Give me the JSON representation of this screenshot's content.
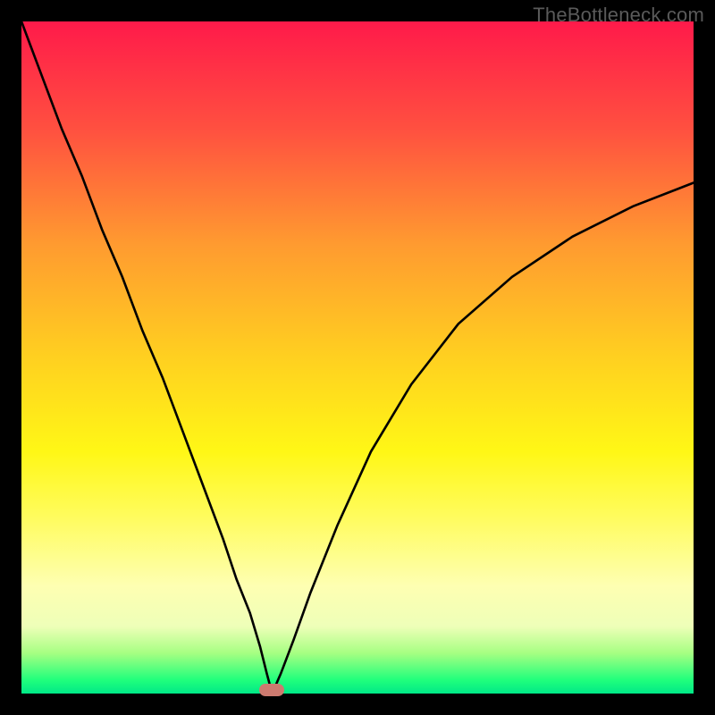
{
  "watermark": "TheBottleneck.com",
  "colors": {
    "frame_border": "#000000",
    "curve_stroke": "#000000",
    "marker_fill": "#cd7a6f"
  },
  "chart_data": {
    "type": "line",
    "title": "",
    "xlabel": "",
    "ylabel": "",
    "xlim": [
      0,
      100
    ],
    "ylim": [
      0,
      100
    ],
    "grid": false,
    "legend": false,
    "series": [
      {
        "name": "left-branch",
        "x": [
          0,
          3,
          6,
          9,
          12,
          15,
          18,
          21,
          24,
          27,
          30,
          32,
          34,
          35.5,
          36.5,
          37.3
        ],
        "y": [
          100,
          92,
          84,
          77,
          69,
          62,
          54,
          47,
          39,
          31,
          23,
          17,
          12,
          7,
          3,
          0
        ]
      },
      {
        "name": "right-branch",
        "x": [
          37.3,
          38.6,
          40.5,
          43,
          47,
          52,
          58,
          65,
          73,
          82,
          91,
          100
        ],
        "y": [
          0,
          3,
          8,
          15,
          25,
          36,
          46,
          55,
          62,
          68,
          72.5,
          76
        ]
      }
    ],
    "annotations": [
      {
        "name": "min-marker",
        "x": 37.3,
        "y": 0
      }
    ],
    "note": "Values are estimated from the plotted pixels; no axes, ticks, or numeric labels are present in the source image."
  }
}
